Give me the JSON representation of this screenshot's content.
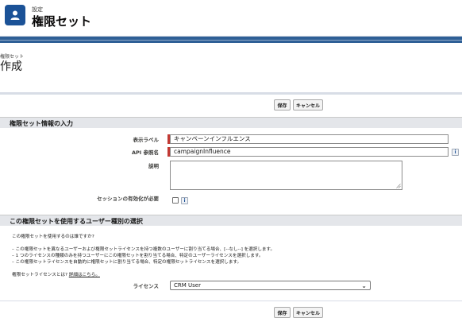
{
  "header": {
    "breadcrumb": "設定",
    "title": "権限セット",
    "icon": "user-icon"
  },
  "permission_set": {
    "label": "権限セット",
    "heading": "作成"
  },
  "buttons": {
    "save": "保存",
    "cancel": "キャンセル"
  },
  "info_section": {
    "title": "権限セット情報の入力",
    "label_field": {
      "label": "表示ラベル",
      "value": "キャンペーンインフルエンス"
    },
    "api_field": {
      "label": "API 参照名",
      "value": "campaignInfluence"
    },
    "description_field": {
      "label": "説明",
      "value": ""
    },
    "session_field": {
      "label": "セッションの有効化が必要",
      "checked": false
    },
    "info_icon_text": "i"
  },
  "license_section": {
    "title": "この権限セットを使用するユーザー種別の選択",
    "question": "この権限セットを使用するのは誰ですか?",
    "bullets": [
      "– この権限セットを異なるユーザーおよび権限セットライセンスを持つ複数のユーザーに割り当てる場合、[--なし--] を選択します。",
      "– 1 つのライセンスの種類のみを持つユーザーにこの権限セットを割り当てる場合、特定のユーザーライセンスを選択します。",
      "– この権限セットライセンスを自動的に権限セットに割り当てる場合、特定の権限セットライセンスを選択します。"
    ],
    "license_help_text": "権限セットライセンスとは?",
    "license_help_link": "詳細はこちら。",
    "license_label": "ライセンス",
    "license_value": "CRM User"
  },
  "colors": {
    "brand": "#1b5297",
    "band": "#2e5f96",
    "required": "#c23934"
  }
}
